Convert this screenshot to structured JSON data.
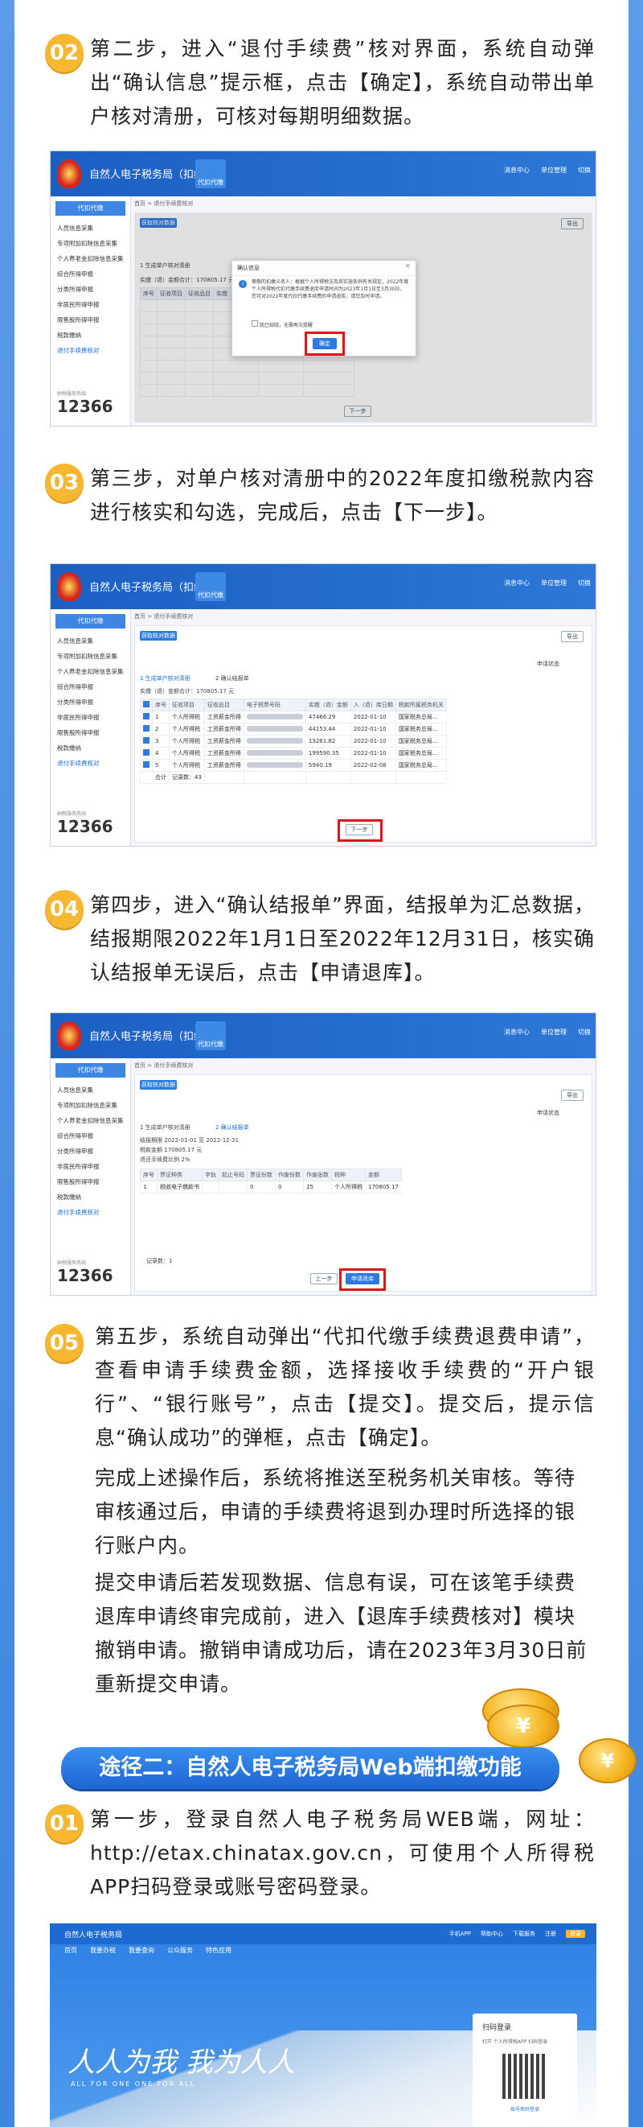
{
  "steps": [
    {
      "num": "02",
      "text": "第二步，进入“退付手续费”核对界面，系统自动弹出“确认信息”提示框，点击【确定】，系统自动带出单户核对清册，可核对每期明细数据。"
    },
    {
      "num": "03",
      "text": "第三步，对单户核对清册中的2022年度扣缴税款内容进行核实和勾选，完成后，点击【下一步】。"
    },
    {
      "num": "04",
      "text": "第四步，进入“确认结报单”界面，结报单为汇总数据，结报期限2022年1月1日至2022年12月31日，核实确认结报单无误后，点击【申请退库】。"
    },
    {
      "num": "05",
      "text": "第五步，系统自动弹出“代扣代缴手续费退费申请”，查看申请手续费金额，选择接收手续费的“开户银行”、“银行账号”，点击【提交】。提交后，提示信息“确认成功”的弹框，点击【确定】。"
    }
  ],
  "paras": [
    "完成上述操作后，系统将推送至税务机关审核。等待审核通过后，申请的手续费将退到办理时所选择的银行账户内。",
    "提交申请后若发现数据、信息有误，可在该笔手续费退库申请终审完成前，进入【退库手续费核对】模块撤销申请。撤销申请成功后，请在2023年3月30日前重新提交申请。"
  ],
  "route2": {
    "title": "途径二：自然人电子税务局Web端扣缴功能",
    "coin_label": "¥"
  },
  "step01": {
    "num": "01",
    "text": "第一步，登录自然人电子税务局WEB端，网址：http://etax.chinatax.gov.cn，可使用个人所得税APP扫码登录或账号密码登录。"
  },
  "app": {
    "title": "自然人电子税务局（扣缴端）",
    "icon_label": "代扣代缴",
    "header_items": [
      "消息中心",
      "单位管理",
      "切换"
    ],
    "side_cap": "代扣代缴",
    "side_items": [
      "人员信息采集",
      "专项附加扣除信息采集",
      "个人养老金扣除信息采集",
      "综合所得申报",
      "分类所得申报",
      "非居民所得申报",
      "限售股所得申报",
      "税款缴纳",
      "退付手续费核对"
    ],
    "logo": "12366",
    "logo_sub": "纳税服务热线",
    "crumb": "首页 > 退付手续费核对",
    "btn_query": "获取核对数据",
    "export": "导出",
    "tab1": "1 生成单户核对清册",
    "tab2": "2 确认结报单",
    "apply_status": "申请状态",
    "summary": "实缴（退）金额合计：170805.17 元",
    "cols": [
      "序号",
      "征收项目",
      "征收品目",
      "电子税票号码",
      "实缴（退）金额",
      "入（退）库日期",
      "税款所属税务机关",
      "退"
    ],
    "rows": [
      {
        "i": "1",
        "p": "个人所得税",
        "item": "工资薪金所得",
        "amt": "47466.29",
        "date": "2022-01-10",
        "org": "国家税务总局..."
      },
      {
        "i": "2",
        "p": "个人所得税",
        "item": "工资薪金所得",
        "amt": "44153.44",
        "date": "2022-01-10",
        "org": "国家税务总局..."
      },
      {
        "i": "3",
        "p": "个人所得税",
        "item": "工资薪金所得",
        "amt": "13261.82",
        "date": "2022-01-10",
        "org": "国家税务总局..."
      },
      {
        "i": "4",
        "p": "个人所得税",
        "item": "工资薪金所得",
        "amt": "199590.35",
        "date": "2022-01-10",
        "org": "国家税务总局..."
      },
      {
        "i": "5",
        "p": "个人所得税",
        "item": "工资薪金所得",
        "amt": "5940.19",
        "date": "2022-02-08",
        "org": "国家税务总局..."
      }
    ],
    "total": "合计",
    "total_count": "记录数：43",
    "next": "下一步",
    "prev": "上一步",
    "apply": "申请退库",
    "dialog_title": "确认信息",
    "dialog_text": "尊敬的扣缴义务人：根据个人所得税法及其实施条例有关规定，2022年度个人所得税代扣代缴手续费退库申请时间为2023年1月1日至3月30日，您可对2022年度代扣代缴手续费的申请退库，请您及时申请。",
    "dialog_check": "我已知晓，无需再次提醒",
    "dialog_ok": "确定",
    "period_label": "结报期限",
    "period_from": "2022-01-01",
    "period_to": "2022-12-31",
    "amount_label": "税款金额",
    "amount": "170805.17 元",
    "fee_label": "退还手续费比例",
    "fee": "2%",
    "c4": [
      "序号",
      "票证种类",
      "字轨",
      "起止号码",
      "票证份数",
      "作废份数",
      "作废张数",
      "税种",
      "项目名称",
      "金额"
    ],
    "r4": {
      "i": "1",
      "kind": "税收电子缴款书",
      "a": "0",
      "b": "0",
      "c": "15",
      "tax": "个人所得税",
      "amt": "170805.17"
    },
    "page": "记录数：1"
  },
  "web": {
    "title": "自然人电子税务局",
    "nav": [
      "首页",
      "我要办税",
      "我要查询",
      "公众服务",
      "特色应用"
    ],
    "top_right": [
      "手机APP",
      "帮助中心",
      "下载服务",
      "注册",
      "登录"
    ],
    "login": "扫码登录",
    "login_sub": "打开 个人所得税APP 扫码登录",
    "slogan": "人人为我 我为人人",
    "slogan_en": "ALL FOR ONE  ONE FOR ALL",
    "qr_hint": "账号密码登录"
  }
}
